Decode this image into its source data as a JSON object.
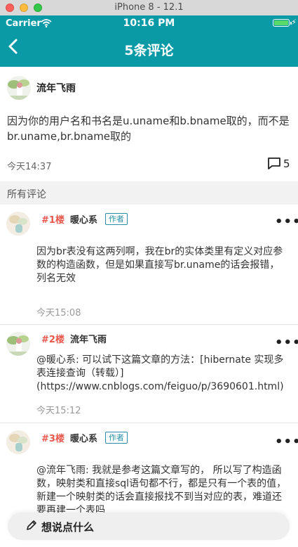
{
  "window": {
    "title": "iPhone 8 - 12.1"
  },
  "status_bar": {
    "carrier": "Carrier",
    "time": "10:16 PM"
  },
  "nav": {
    "title": "5条评论"
  },
  "post": {
    "author": "流年飞雨",
    "text": "因为你的用户名和书名是u.uname和b.bname取的，而不是br.uname,br.bname取的",
    "time": "今天14:37",
    "comment_count": "5"
  },
  "section_title": "所有评论",
  "comments": [
    {
      "floor": "#1楼",
      "author": "暖心系",
      "badge": "作者",
      "text": "因为br表没有这两列啊，我在br的实体类里有定义对应参数的构造函数，但是如果直接写br.uname的话会报错，列名无效",
      "time": "今天15:08"
    },
    {
      "floor": "#2楼",
      "author": "流年飞雨",
      "text": "@暖心系: 可以试下这篇文章的方法：[hibernate 实现多表连接查询（转载）](https://www.cnblogs.com/feiguo/p/3690601.html)",
      "time": "今天15:12"
    },
    {
      "floor": "#3楼",
      "author": "暖心系",
      "badge": "作者",
      "text": "@流年飞雨: 我就是参考这篇文章写的， 所以写了构造函数，映射类和直接sql语句都不行，都是只有一个表的值，新建一个映射类的话会直接报找不到当对应的表，难道还要再建一个表吗"
    }
  ],
  "compose": {
    "placeholder": "想说点什么"
  },
  "colors": {
    "nav_bg": "#0a9aa6",
    "floor": "#e8584d",
    "badge": "#2a8fa6"
  },
  "icons": {
    "back": "chevron-left-icon",
    "comment": "speech-bubble-icon",
    "more": "ellipsis-icon",
    "compose": "pencil-icon"
  }
}
